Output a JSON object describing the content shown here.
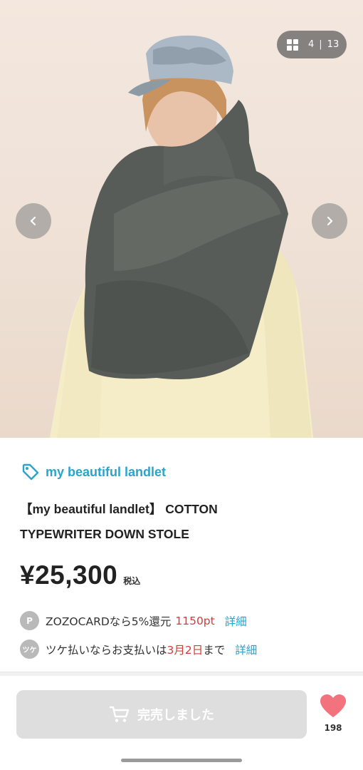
{
  "gallery": {
    "current": "4",
    "separator": "|",
    "total": "13",
    "grid_icon": "grid-icon",
    "prev_icon": "chevron-left-icon",
    "next_icon": "chevron-right-icon"
  },
  "product": {
    "brand": "my beautiful landlet",
    "brand_icon": "tag-icon",
    "title_line1": "【my beautiful landlet】 COTTON",
    "title_line2": "TYPEWRITER DOWN STOLE",
    "price": "¥25,300",
    "tax_label": "税込"
  },
  "zozocard": {
    "badge": "P",
    "text": "ZOZOCARDなら5%還元",
    "points": "1150pt",
    "link": "詳細"
  },
  "tsuke": {
    "badge": "ツケ",
    "text_before": "ツケ払いならお支払いは",
    "date": "3月2日",
    "text_after": "まで",
    "link": "詳細"
  },
  "footer": {
    "buy_label": "完売しました",
    "cart_icon": "cart-icon",
    "favorite_icon": "heart-icon",
    "favorite_count": "198"
  },
  "colors": {
    "accent": "#2aa4c9",
    "price_red": "#d83a3a",
    "heart": "#f2727e",
    "disabled_button": "#dedede"
  }
}
